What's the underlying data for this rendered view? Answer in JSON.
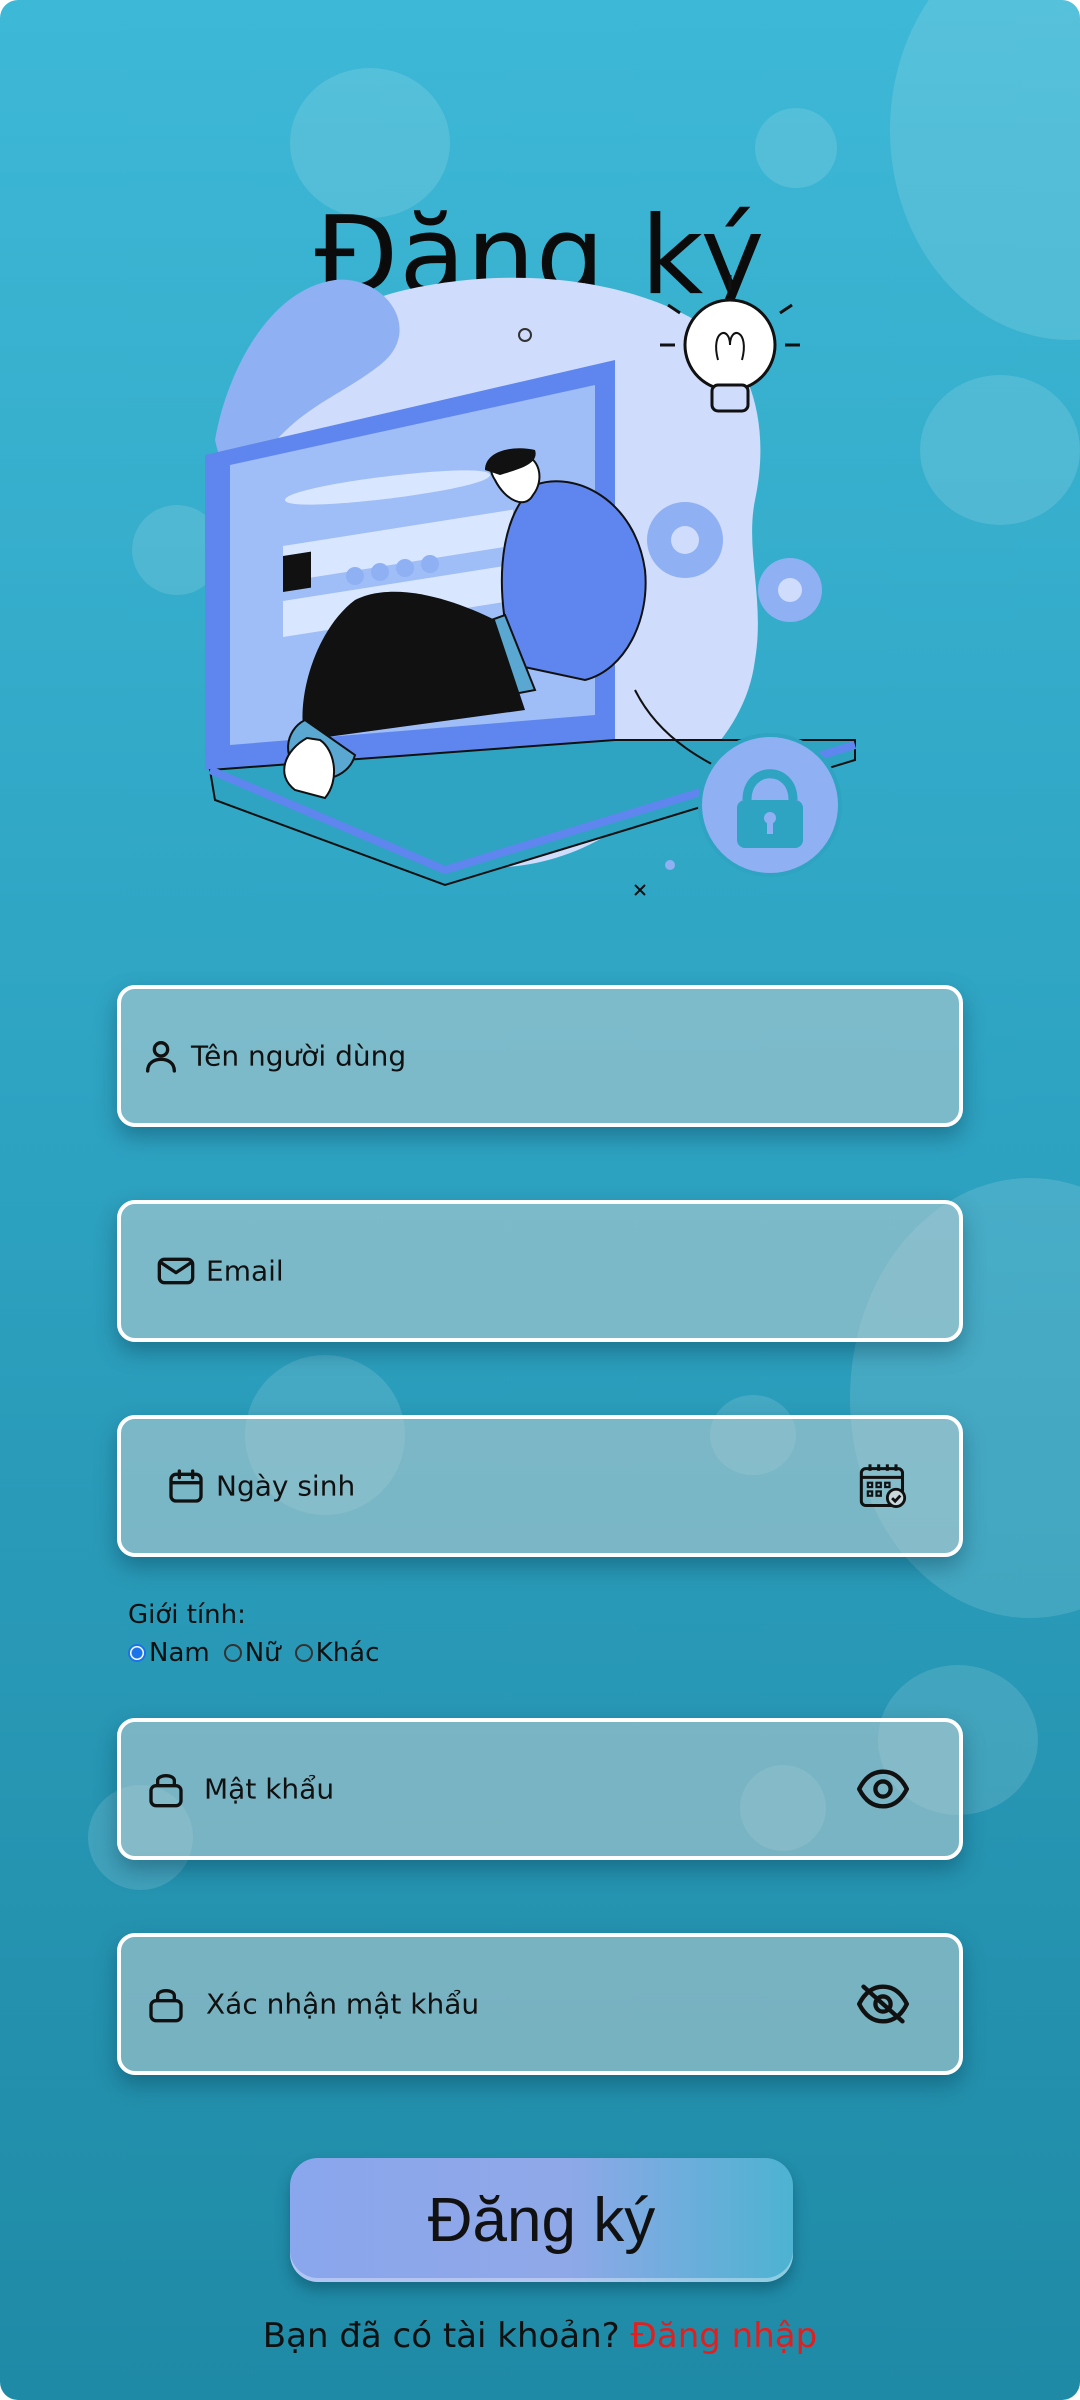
{
  "page": {
    "title": "Đăng ký"
  },
  "form": {
    "username": {
      "placeholder": "Tên người dùng"
    },
    "email": {
      "placeholder": "Email"
    },
    "birthday": {
      "placeholder": "Ngày sinh"
    },
    "gender": {
      "label": "Giới tính:",
      "options": [
        "Nam",
        "Nữ",
        "Khác"
      ],
      "selected": "Nam"
    },
    "password": {
      "placeholder": "Mật khẩu"
    },
    "confirm_password": {
      "placeholder": "Xác nhận mật khẩu"
    },
    "submit_label": "Đăng ký"
  },
  "footer": {
    "prompt": "Bạn đã có tài khoản?",
    "login_link": "Đăng nhập"
  },
  "colors": {
    "accent_link": "#e02020",
    "radio_selected": "#1a73e8",
    "button_gradient_start": "#8aa6ec",
    "button_gradient_end": "#4db3d1"
  },
  "icons": {
    "username": "user-icon",
    "email": "mail-icon",
    "birthday": "calendar-icon",
    "birthday_picker": "calendar-check-icon",
    "password": "lock-icon",
    "password_toggle": "eye-icon",
    "confirm_password": "lock-icon",
    "confirm_password_toggle": "eye-off-icon"
  }
}
